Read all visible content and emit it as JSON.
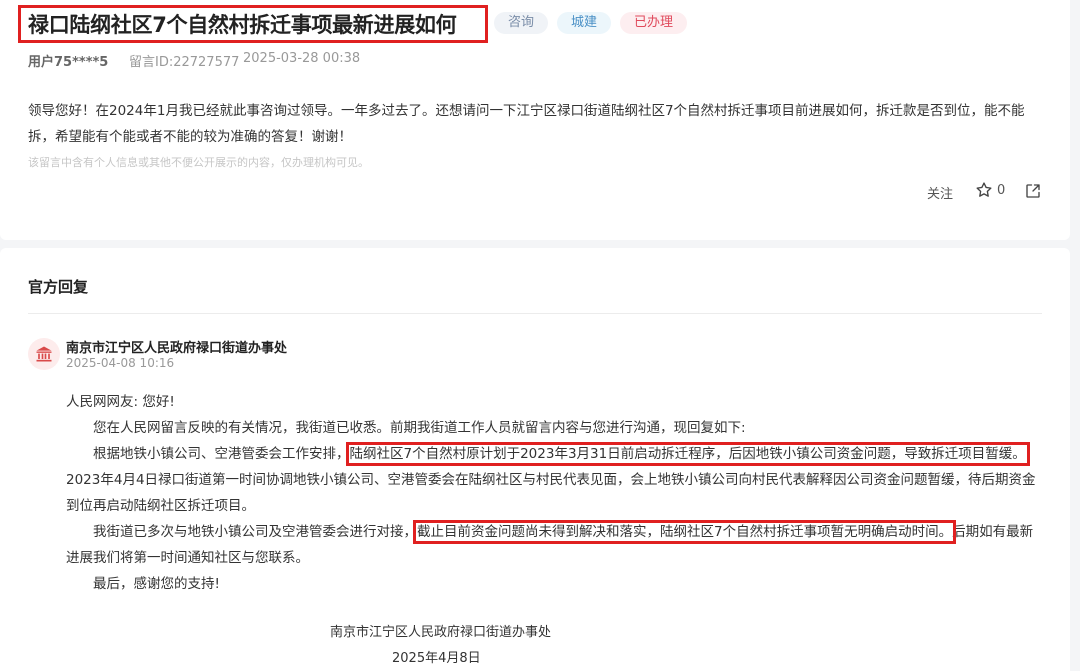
{
  "message": {
    "title": "禄口陆纲社区7个自然村拆迁事项最新进展如何",
    "tags": [
      "咨询",
      "城建",
      "已办理"
    ],
    "user": "用户75****5",
    "message_id": "留言ID:22727577",
    "datetime": "2025-03-28 00:38",
    "content": "领导您好！在2024年1月我已经就此事咨询过领导。一年多过去了。还想请问一下江宁区禄口街道陆纲社区7个自然村拆迁事项目前进展如何，拆迁款是否到位，能不能拆，希望能有个能或者不能的较为准确的答复！谢谢！",
    "privacy_notice": "该留言中含有个人信息或其他不便公开展示的内容，仅办理机构可见。",
    "actions": {
      "follow_label": "关注",
      "star_count": "0"
    }
  },
  "reply": {
    "heading": "官方回复",
    "org_name": "南京市江宁区人民政府禄口街道办事处",
    "datetime": "2025-04-08 10:16",
    "greeting": "人民网网友: 您好!",
    "p1": "您在人民网留言反映的有关情况，我街道已收悉。前期我街道工作人员就留言内容与您进行沟通，现回复如下:",
    "p2_a": "根据地铁小镇公司、空港管委会工作安排，",
    "p2_b": "陆纲社区7个自然村原计划于2023年3月31日前启动拆迁程序，后因地铁小镇公司资金问题，导致拆迁项目暂缓。",
    "p2_c": "2023年4月4日禄口街道第一时间协调地铁小镇公司、空港管委会在陆纲社区与村民代表见面，会上地铁小镇公司向村民代表解释因公司资金问题暂缓，待后期资金到位再启动陆纲社区拆迁项目。",
    "p3_a": "我街道已多次与地铁小镇公司及空港管委会进行对接，",
    "p3_b": "截止目前资金问题尚未得到解决和落实，陆纲社区7个自然村拆迁事项暂无明确启动时间。",
    "p3_c": "后期如有最新进展我们将第一时间通知社区与您联系。",
    "p4": "最后，感谢您的支持!",
    "sign_org": "南京市江宁区人民政府禄口街道办事处",
    "sign_date": "2025年4月8日"
  },
  "colors": {
    "highlight_box": "#e02020",
    "tag_done": "#e04a5c",
    "tag_build": "#4a90c6",
    "tag_consult": "#7a8da8"
  }
}
